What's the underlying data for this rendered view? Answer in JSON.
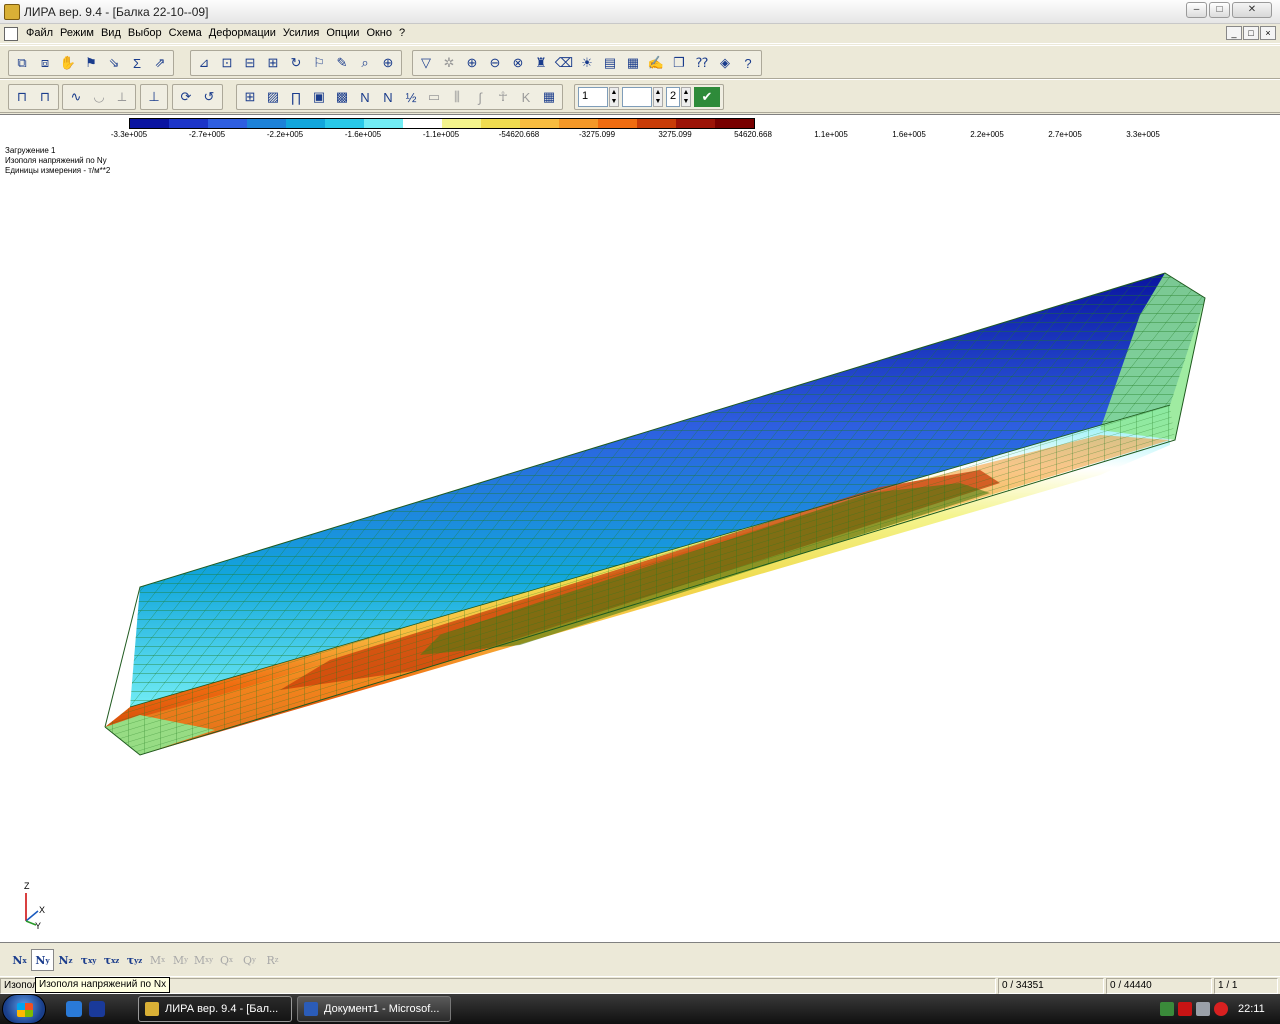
{
  "window": {
    "title": "ЛИРА  вер. 9.4 - [Балка 22-10--09]",
    "minimize_glyph": "–",
    "maximize_glyph": "□",
    "close_glyph": "✕"
  },
  "menu": [
    "Файл",
    "Режим",
    "Вид",
    "Выбор",
    "Схема",
    "Деформации",
    "Усилия",
    "Опции",
    "Окно",
    "?"
  ],
  "mdi_buttons": [
    "_",
    "□",
    "×"
  ],
  "toolbar2": {
    "spin1": "1",
    "spin2": "",
    "spin3": "2"
  },
  "legend": {
    "colors": [
      "#0a14a0",
      "#1c35c8",
      "#2e5ee0",
      "#1d82d8",
      "#12a6dc",
      "#29c8e8",
      "#72ecf4",
      "#ffffff",
      "#f4f48c",
      "#f0dc50",
      "#f8bc40",
      "#f49828",
      "#f06c10",
      "#c83c08",
      "#9c1408",
      "#780000"
    ],
    "ticks": [
      "-3.3e+005",
      "-2.7e+005",
      "-2.2e+005",
      "-1.6e+005",
      "-1.1e+005",
      "-54620.668",
      "-3275.099",
      "3275.099",
      "54620.668",
      "1.1e+005",
      "1.6e+005",
      "2.2e+005",
      "2.7e+005",
      "3.3e+005"
    ]
  },
  "info": {
    "line1": "Загружение  1",
    "line2": "Изополя напряжений по Ny",
    "line3": "Единицы измерения - т/м**2"
  },
  "axes": {
    "z": "Z",
    "x": "X",
    "y": "Y"
  },
  "stress_buttons": [
    {
      "main": "N",
      "sub": "x"
    },
    {
      "main": "N",
      "sub": "y"
    },
    {
      "main": "N",
      "sub": "z"
    },
    {
      "main": "τ",
      "sub": "xy"
    },
    {
      "main": "τ",
      "sub": "xz"
    },
    {
      "main": "τ",
      "sub": "yz"
    },
    {
      "main": "M",
      "sub": "x"
    },
    {
      "main": "M",
      "sub": "y"
    },
    {
      "main": "M",
      "sub": "xy"
    },
    {
      "main": "Q",
      "sub": "x"
    },
    {
      "main": "Q",
      "sub": "y"
    },
    {
      "main": "R",
      "sub": "z"
    }
  ],
  "status": {
    "left": "Изопол",
    "tooltip": "Изополя напряжений по Nx",
    "nodes": "0 / 34351",
    "elements": "0 / 44440",
    "page": "1 / 1"
  },
  "taskbar": {
    "tasks": [
      "ЛИРА  вер. 9.4 - [Бал...",
      "Документ1 - Microsof..."
    ],
    "clock": "22:11"
  }
}
